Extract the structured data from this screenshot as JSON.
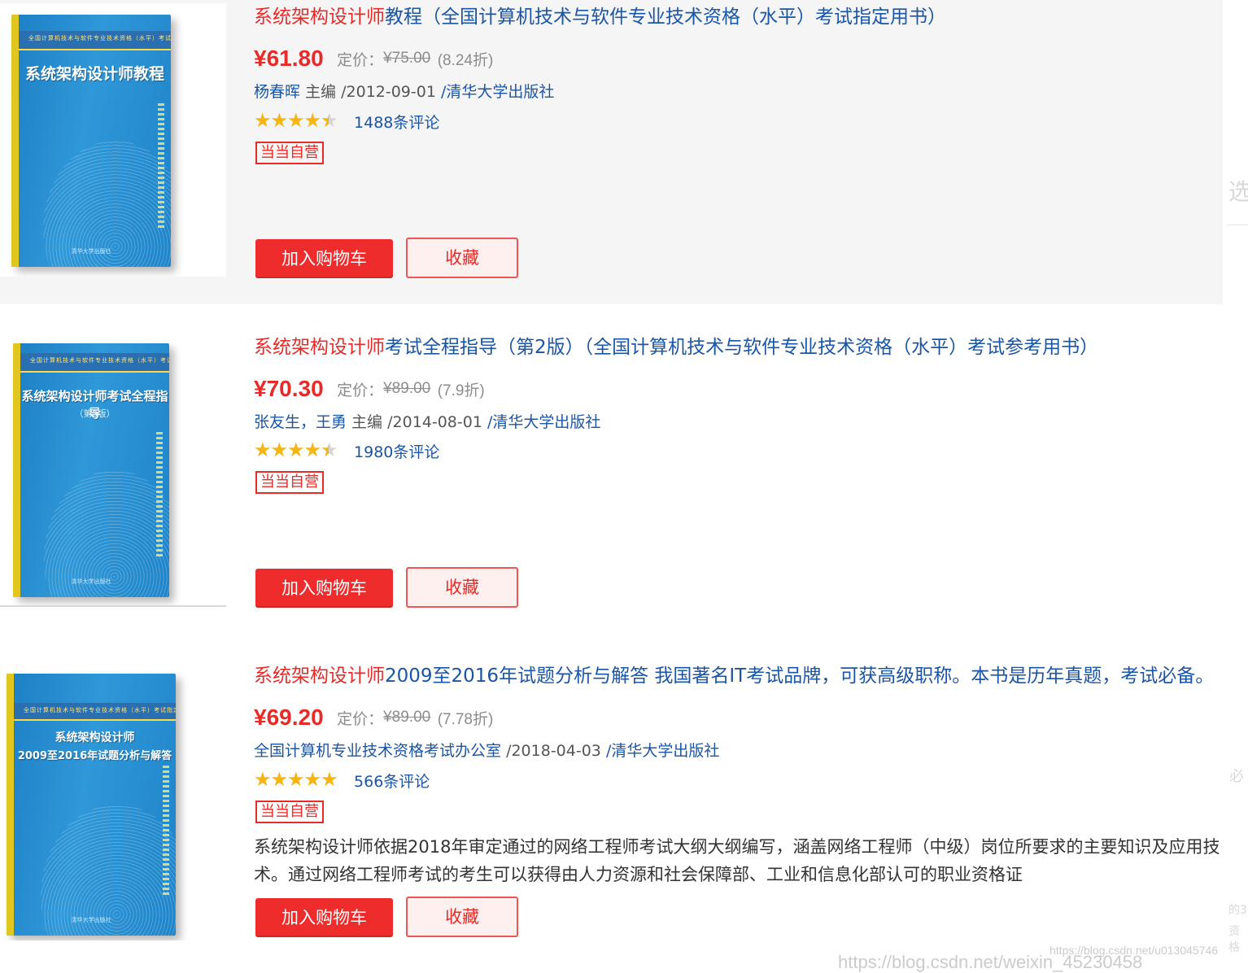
{
  "products": [
    {
      "title_keyword": "系统架构设计师",
      "title_rest": "教程（全国计算机技术与软件专业技术资格（水平）考试指定用书）",
      "price": "¥61.80",
      "list_label": "定价：",
      "list_price": "¥75.00",
      "discount": "(8.24折)",
      "authors": "杨春晖",
      "author_role": " 主编 ",
      "date": "/2012-09-01 ",
      "publisher": "/清华大学出版社",
      "rating": 4.5,
      "reviews": "1488条评论",
      "badge": "当当自营",
      "cart_label": "加入购物车",
      "fav_label": "收藏",
      "cover": {
        "band_text": "全国计算机技术与软件专业技术资格（水平）考试指定用书",
        "title": "系统架构设计师教程",
        "subtitle": "",
        "publisher": "清华大学出版社"
      }
    },
    {
      "title_keyword": "系统架构设计师",
      "title_rest": "考试全程指导（第2版）（全国计算机技术与软件专业技术资格（水平）考试参考用书）",
      "price": "¥70.30",
      "list_label": "定价：",
      "list_price": "¥89.00",
      "discount": "(7.9折)",
      "authors": "张友生，王勇",
      "author_role": " 主编 ",
      "date": "/2014-08-01 ",
      "publisher": "/清华大学出版社",
      "rating": 4.5,
      "reviews": "1980条评论",
      "badge": "当当自营",
      "cart_label": "加入购物车",
      "fav_label": "收藏",
      "cover": {
        "band_text": "全国计算机技术与软件专业技术资格（水平）考试参考用书",
        "title": "系统架构设计师考试全程指导",
        "subtitle": "（第2版）",
        "publisher": "清华大学出版社"
      }
    },
    {
      "title_keyword": "系统架构设计师",
      "title_rest": "2009至2016年试题分析与解答 我国著名IT考试品牌，可获高级职称。本书是历年真题，考试必备。",
      "price": "¥69.20",
      "list_label": "定价：",
      "list_price": "¥89.00",
      "discount": "(7.78折)",
      "authors": "全国计算机专业技术资格考试办公室",
      "author_role": " ",
      "date": "/2018-04-03 ",
      "publisher": "/清华大学出版社",
      "rating": 5,
      "reviews": "566条评论",
      "badge": "当当自营",
      "description": "系统架构设计师依据2018年审定通过的网络工程师考试大纲大纲编写，涵盖网络工程师（中级）岗位所要求的主要知识及应用技术。通过网络工程师考试的考生可以获得由人力资源和社会保障部、工业和信息化部认可的职业资格证",
      "cart_label": "加入购物车",
      "fav_label": "收藏",
      "cover": {
        "band_text": "全国计算机技术与软件专业技术资格（水平）考试指定用书",
        "title": "系统架构设计师",
        "subtitle": "2009至2016年试题分析与解答",
        "publisher": "清华大学出版社"
      }
    }
  ],
  "side_fragments": [
    "选",
    "必",
    "的3",
    "资格"
  ],
  "watermarks": [
    "https://blog.csdn.net/u013045746",
    "https://blog.csdn.net/weixin_45230458"
  ]
}
